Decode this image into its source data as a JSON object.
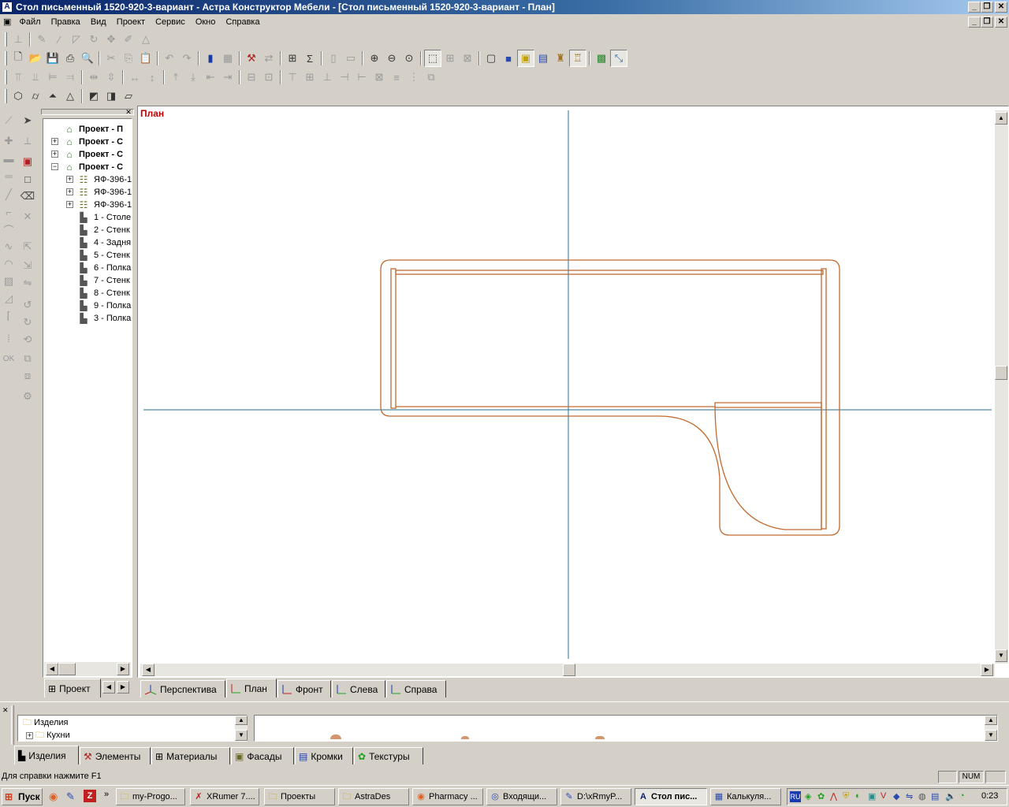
{
  "window": {
    "title": "Стол письменный 1520-920-3-вариант - Астра Конструктор Мебели - [Стол письменный 1520-920-3-вариант - План]"
  },
  "menu": [
    "Файл",
    "Правка",
    "Вид",
    "Проект",
    "Сервис",
    "Окно",
    "Справка"
  ],
  "tree": {
    "items": [
      {
        "label": "Проект - П",
        "bold": true
      },
      {
        "label": "Проект - С",
        "bold": true
      },
      {
        "label": "Проект - С",
        "bold": true
      },
      {
        "label": "Проект - С",
        "bold": true
      },
      {
        "label": "ЯФ-396-1"
      },
      {
        "label": "ЯФ-396-1"
      },
      {
        "label": "ЯФ-396-1"
      },
      {
        "label": "1 - Столе"
      },
      {
        "label": "2 - Стенк"
      },
      {
        "label": "4 - Задня"
      },
      {
        "label": "5 - Стенк"
      },
      {
        "label": "6 - Полка"
      },
      {
        "label": "7 - Стенк"
      },
      {
        "label": "8 - Стенк"
      },
      {
        "label": "9 - Полка"
      },
      {
        "label": "3 - Полка"
      }
    ],
    "tab_label": "Проект"
  },
  "view": {
    "label": "План",
    "tabs": [
      "Перспектива",
      "План",
      "Фронт",
      "Слева",
      "Справа"
    ],
    "active_tab": "План"
  },
  "library": {
    "folders": [
      "Изделия",
      "Кухни"
    ],
    "tabs": [
      "Изделия",
      "Элементы",
      "Материалы",
      "Фасады",
      "Кромки",
      "Текстуры"
    ],
    "active_tab": "Изделия"
  },
  "status": {
    "help": "Для справки нажмите F1",
    "num": "NUM"
  },
  "taskbar": {
    "start": "Пуск",
    "items": [
      "my-Progo...",
      "XRumer 7....",
      "Проекты",
      "AstraDes",
      "Pharmacy ...",
      "Входящи...",
      "D:\\xRmyP...",
      "Стол пис...",
      "Калькуля..."
    ],
    "active": "Стол пис...",
    "lang": "RU",
    "clock": "0:23"
  },
  "colors": {
    "titlebar": "#0a246a",
    "drawing": "#c06a30",
    "axis": "#2a6f8f",
    "viewlabel": "#c00000"
  }
}
